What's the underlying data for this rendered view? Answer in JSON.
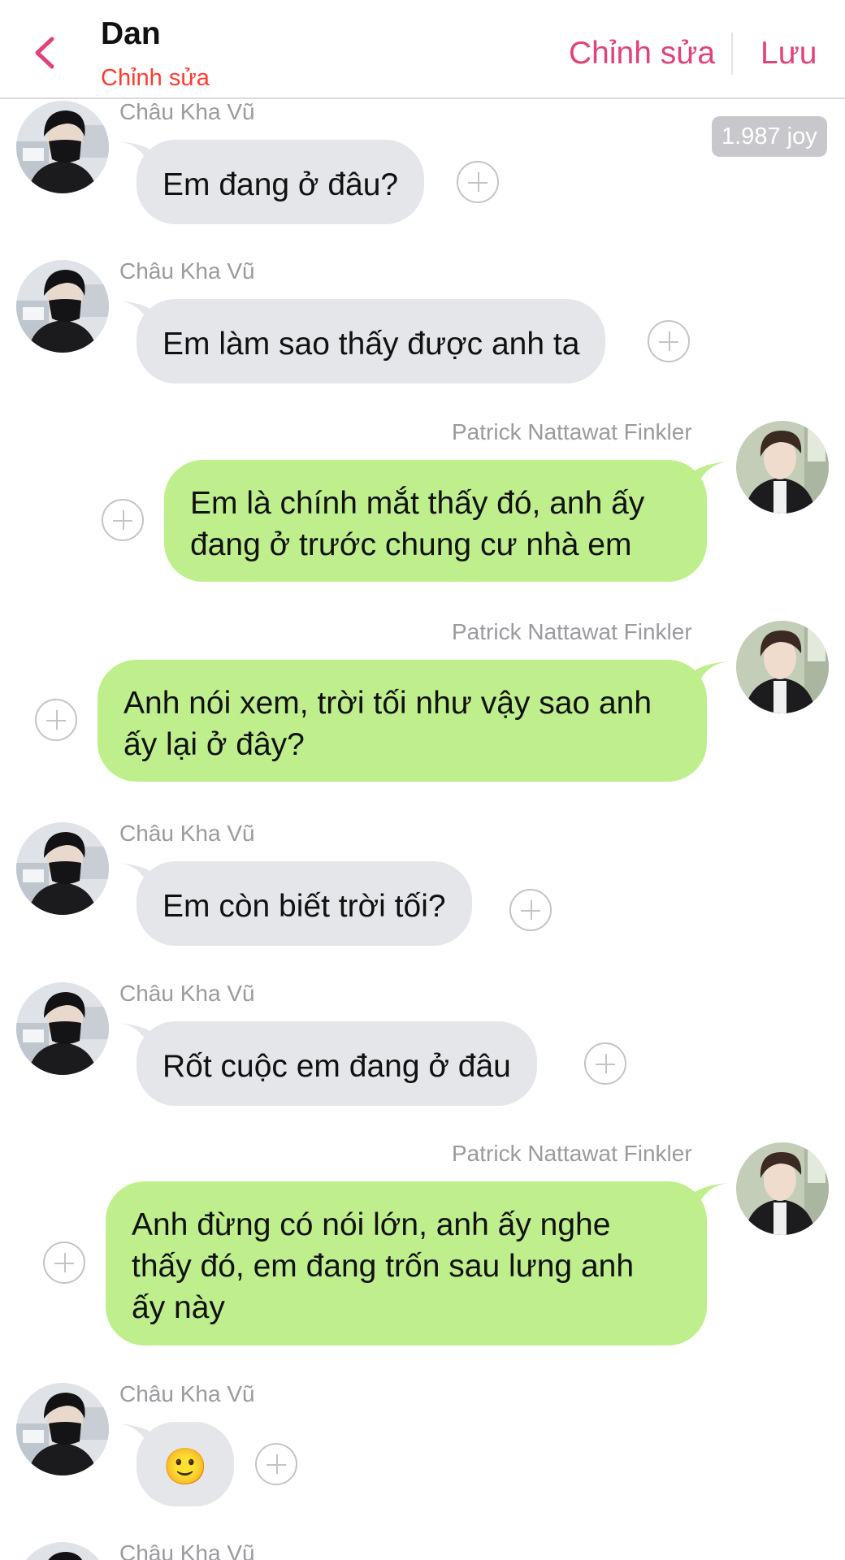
{
  "header": {
    "title": "Dan",
    "subtitle": "Chỉnh sửa",
    "edit_label": "Chỉnh sửa",
    "save_label": "Lưu",
    "accent_color": "#e0427b"
  },
  "badge": {
    "joy_label": "1.987 joy"
  },
  "messages": [
    {
      "side": "incoming",
      "sender": "Châu Kha Vũ",
      "text": "Em đang ở đâu?"
    },
    {
      "side": "incoming",
      "sender": "Châu Kha Vũ",
      "text": "Em làm sao thấy được anh ta"
    },
    {
      "side": "outgoing",
      "sender": "Patrick Nattawat Finkler",
      "lines": [
        "Em là chính mắt thấy đó, anh ấy",
        "đang ở trước chung cư nhà em"
      ]
    },
    {
      "side": "outgoing",
      "sender": "Patrick Nattawat Finkler",
      "lines": [
        "Anh nói xem, trời tối như vậy sao anh",
        "ấy lại ở đây?"
      ]
    },
    {
      "side": "incoming",
      "sender": "Châu Kha Vũ",
      "text": "Em còn biết trời tối?"
    },
    {
      "side": "incoming",
      "sender": "Châu Kha Vũ",
      "text": "Rốt cuộc em đang ở đâu"
    },
    {
      "side": "outgoing",
      "sender": "Patrick Nattawat Finkler",
      "lines": [
        "Anh đừng có nói lớn, anh ấy nghe",
        "thấy đó, em đang trốn sau lưng anh",
        "ấy này"
      ]
    },
    {
      "side": "incoming",
      "sender": "Châu Kha Vũ",
      "text": "🙂"
    },
    {
      "side": "incoming",
      "sender": "Châu Kha Vũ",
      "text": ""
    }
  ],
  "icons": {
    "back": "chevron-left-icon",
    "add": "plus-circle-icon",
    "avatar_incoming": "avatar-masked-person-icon",
    "avatar_outgoing": "avatar-person-icon"
  },
  "colors": {
    "incoming_bubble": "#e4e6ea",
    "outgoing_bubble": "#bfee8c",
    "sender_text": "#9a9a9f",
    "subtitle": "#ff3b30"
  }
}
